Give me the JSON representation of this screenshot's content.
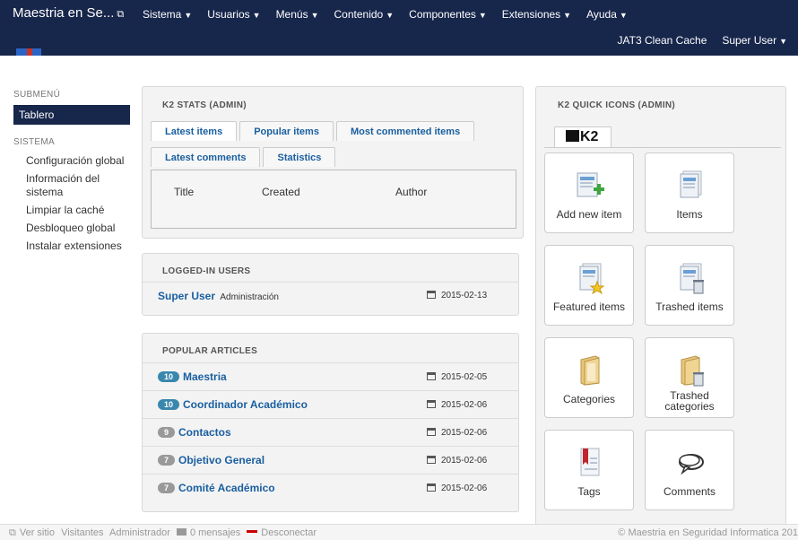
{
  "navbar": {
    "brand": "Maestria en Se...",
    "brand_icon": "external-link-icon",
    "menu": [
      "Sistema",
      "Usuarios",
      "Menús",
      "Contenido",
      "Componentes",
      "Extensiones",
      "Ayuda"
    ],
    "right": [
      "JAT3 Clean Cache",
      "Super User"
    ],
    "bg_color": "#17264b"
  },
  "sidebar": {
    "submenu_heading": "SUBMENÚ",
    "active_item": "Tablero",
    "system_heading": "SISTEMA",
    "items": [
      "Configuración global",
      "Información del sistema",
      "Limpiar la caché",
      "Desbloqueo global",
      "Instalar extensiones"
    ]
  },
  "k2stats": {
    "title": "K2 STATS (ADMIN)",
    "tabs": [
      "Latest items",
      "Popular items",
      "Most commented items",
      "Latest comments",
      "Statistics"
    ],
    "columns": [
      "Title",
      "Created",
      "Author"
    ]
  },
  "logged_users": {
    "title": "LOGGED-IN USERS",
    "rows": [
      {
        "name": "Super User",
        "role": "Administración",
        "date": "2015-02-13"
      }
    ]
  },
  "popular_articles": {
    "title": "POPULAR ARTICLES",
    "rows": [
      {
        "hits": "10",
        "title": "Maestria",
        "date": "2015-02-05",
        "badge": "blue"
      },
      {
        "hits": "10",
        "title": "Coordinador Académico",
        "date": "2015-02-06",
        "badge": "blue"
      },
      {
        "hits": "9",
        "title": "Contactos",
        "date": "2015-02-06",
        "badge": "gray"
      },
      {
        "hits": "7",
        "title": "Objetivo General",
        "date": "2015-02-06",
        "badge": "gray"
      },
      {
        "hits": "7",
        "title": "Comité Académico",
        "date": "2015-02-06",
        "badge": "gray"
      }
    ]
  },
  "quick_icons": {
    "title": "K2 QUICK ICONS (ADMIN)",
    "logo": "K2",
    "items": [
      {
        "label": "Add new item",
        "icon": "add-item-icon"
      },
      {
        "label": "Items",
        "icon": "items-icon"
      },
      {
        "label": "Featured items",
        "icon": "featured-items-icon"
      },
      {
        "label": "Trashed items",
        "icon": "trashed-items-icon"
      },
      {
        "label": "Categories",
        "icon": "categories-icon"
      },
      {
        "label": "Trashed categories",
        "icon": "trashed-categories-icon"
      },
      {
        "label": "Tags",
        "icon": "tags-icon"
      },
      {
        "label": "Comments",
        "icon": "comments-icon"
      }
    ]
  },
  "footer": {
    "view_site": "Ver sitio",
    "visitors": "Visitantes",
    "admin": "Administrador",
    "messages": "0 mensajes",
    "logout": "Desconectar",
    "copyright": "© Maestria en Seguridad Informatica 201"
  }
}
